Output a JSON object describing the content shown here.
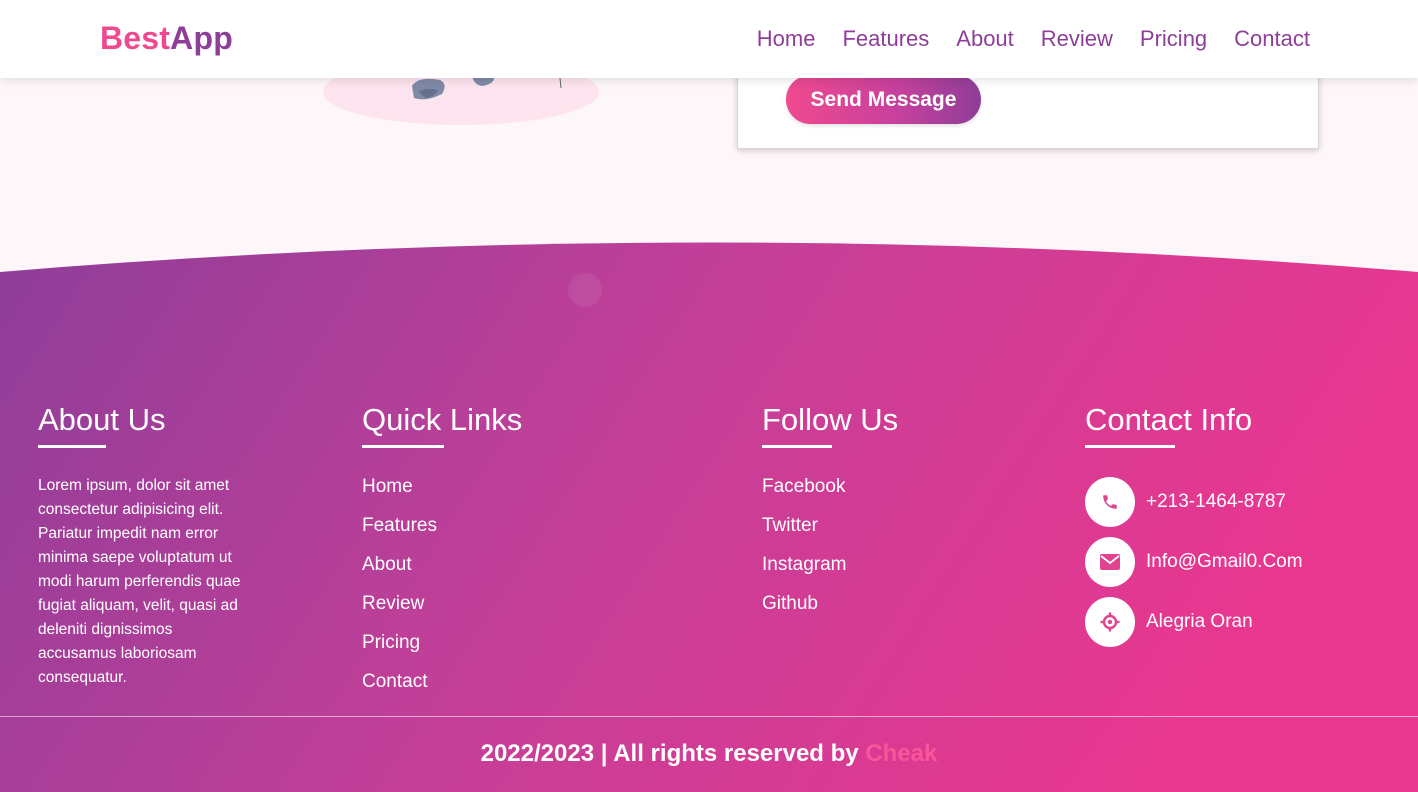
{
  "brand": {
    "part1": "Best",
    "part2": "App"
  },
  "nav": {
    "items": [
      "Home",
      "Features",
      "About",
      "Review",
      "Pricing",
      "Contact"
    ]
  },
  "contact_form": {
    "send_label": "Send Message"
  },
  "footer": {
    "about": {
      "heading": "About Us",
      "text": "Lorem ipsum, dolor sit amet consectetur adipisicing elit. Pariatur impedit nam error minima saepe voluptatum ut modi harum perferendis quae fugiat aliquam, velit, quasi ad deleniti dignissimos accusamus laboriosam consequatur."
    },
    "quick_links": {
      "heading": "Quick Links",
      "items": [
        "Home",
        "Features",
        "About",
        "Review",
        "Pricing",
        "Contact"
      ]
    },
    "follow": {
      "heading": "Follow Us",
      "items": [
        "Facebook",
        "Twitter",
        "Instagram",
        "Github"
      ]
    },
    "contact_info": {
      "heading": "Contact Info",
      "phone": "+213-1464-8787",
      "email": "Info@Gmail0.Com",
      "location": "Alegria Oran"
    },
    "copyright": {
      "text": "2022/2023 | All rights reserved by",
      "brand": "Cheak"
    }
  },
  "colors": {
    "pink": "#ef4a8f",
    "purple": "#8e3e99",
    "footer_left": "#8e3e99",
    "footer_right": "#e9378f"
  },
  "icons": {
    "phone": "phone-icon",
    "email": "envelope-icon",
    "location": "location-crosshair-icon"
  }
}
